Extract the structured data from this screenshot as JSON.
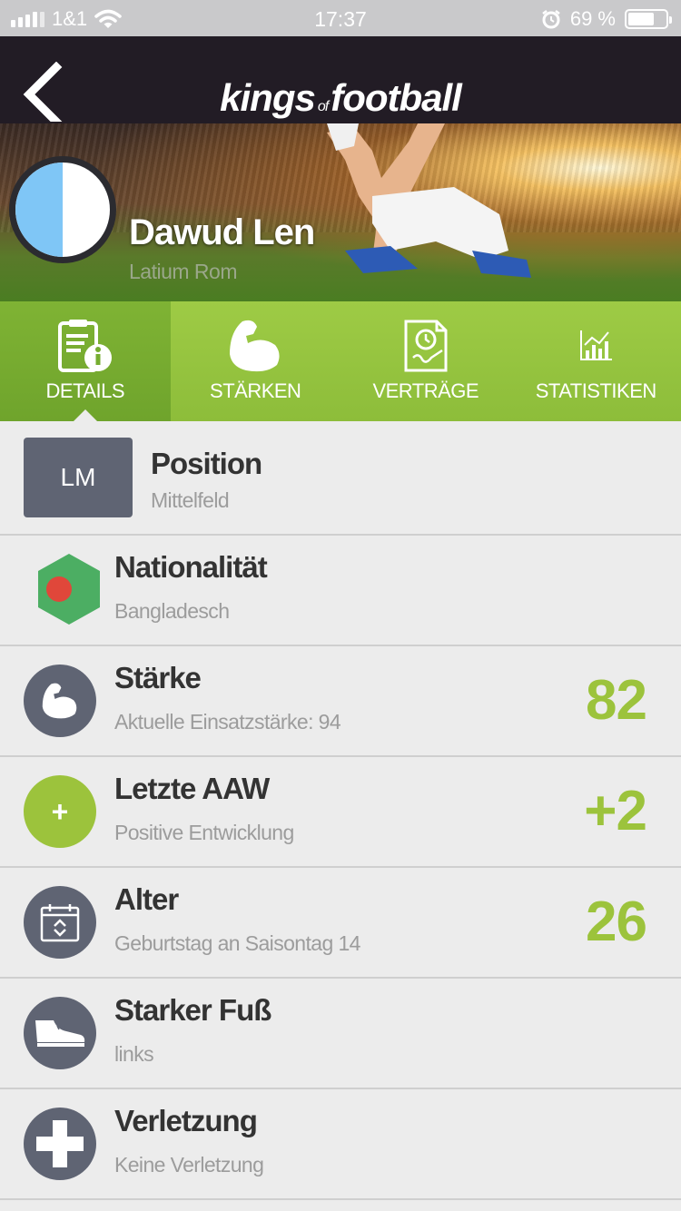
{
  "status_bar": {
    "carrier": "1&1",
    "time": "17:37",
    "battery": "69 %",
    "battery_level": 0.69
  },
  "header": {
    "logo_word1": "kings",
    "logo_word2": "of",
    "logo_word3": "football"
  },
  "player": {
    "name": "Dawud Len",
    "club": "Latium Rom"
  },
  "tabs": [
    {
      "label": "DETAILS",
      "icon": "details-info-icon",
      "active": true
    },
    {
      "label": "STÄRKEN",
      "icon": "bicep-icon",
      "active": false
    },
    {
      "label": "VERTRÄGE",
      "icon": "contract-icon",
      "active": false
    },
    {
      "label": "STATISTIKEN",
      "icon": "chart-icon",
      "active": false
    }
  ],
  "rows": {
    "position": {
      "badge": "LM",
      "title": "Position",
      "sub": "Mittelfeld"
    },
    "nationality": {
      "title": "Nationalität",
      "sub": "Bangladesch",
      "icon": "bangladesh-flag-icon"
    },
    "strength": {
      "title": "Stärke",
      "sub": "Aktuelle Einsatzstärke: 94",
      "value": "82",
      "icon": "bicep-icon"
    },
    "last_aaw": {
      "title": "Letzte AAW",
      "sub": "Positive Entwicklung",
      "value": "+2",
      "icon_symbol": "+"
    },
    "age": {
      "title": "Alter",
      "sub": "Geburtstag an Saisontag 14",
      "value": "26",
      "icon": "calendar-icon"
    },
    "foot": {
      "title": "Starker Fuß",
      "sub": "links",
      "icon": "football-boot-icon"
    },
    "injury": {
      "title": "Verletzung",
      "sub": "Keine Verletzung",
      "icon": "medical-cross-icon"
    }
  },
  "colors": {
    "accent_green": "#9cc33c",
    "tab_green": "#8dbd3a",
    "icon_gray": "#5f6473",
    "header_dark": "#221c25",
    "flag_green": "#4cae63",
    "flag_red": "#e0473a"
  }
}
